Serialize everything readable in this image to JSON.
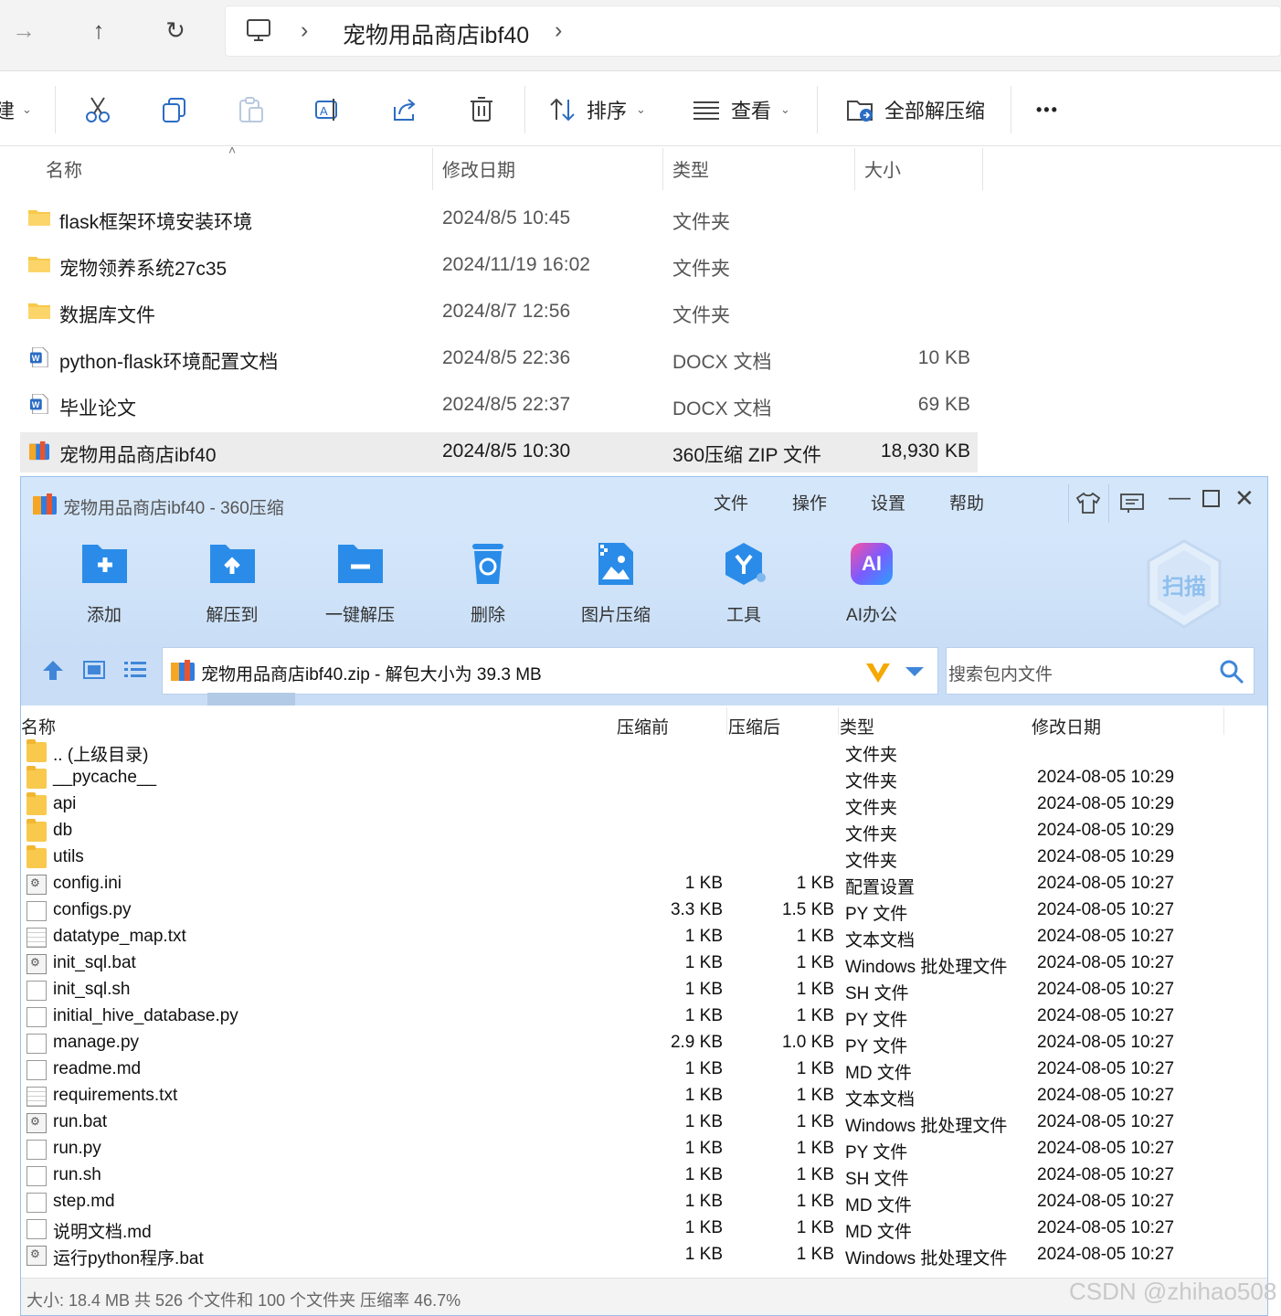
{
  "explorer": {
    "address": {
      "crumb": "宠物用品商店ibf40"
    },
    "toolbar": {
      "new_label": "建",
      "sort_label": "排序",
      "view_label": "查看",
      "extract_all_label": "全部解压缩",
      "more_label": "•••"
    },
    "columns": {
      "name": "名称",
      "modified": "修改日期",
      "type": "类型",
      "size": "大小"
    },
    "files": [
      {
        "name": "flask框架环境安装环境",
        "modified": "2024/8/5 10:45",
        "type": "文件夹",
        "size": "",
        "icon": "folder-icon"
      },
      {
        "name": "宠物领养系统27c35",
        "modified": "2024/11/19 16:02",
        "type": "文件夹",
        "size": "",
        "icon": "folder-icon"
      },
      {
        "name": "数据库文件",
        "modified": "2024/8/7 12:56",
        "type": "文件夹",
        "size": "",
        "icon": "folder-icon"
      },
      {
        "name": "python-flask环境配置文档",
        "modified": "2024/8/5 22:36",
        "type": "DOCX 文档",
        "size": "10 KB",
        "icon": "word-doc-icon"
      },
      {
        "name": "毕业论文",
        "modified": "2024/8/5 22:37",
        "type": "DOCX 文档",
        "size": "69 KB",
        "icon": "word-doc-icon"
      },
      {
        "name": "宠物用品商店ibf40",
        "modified": "2024/8/5 10:30",
        "type": "360压缩 ZIP 文件",
        "size": "18,930 KB",
        "icon": "zip-archive-icon",
        "selected": true
      }
    ]
  },
  "zip360": {
    "title": "宠物用品商店ibf40 - 360压缩",
    "menu": [
      "文件",
      "操作",
      "设置",
      "帮助"
    ],
    "tools": [
      {
        "label": "添加",
        "icon": "add-icon"
      },
      {
        "label": "解压到",
        "icon": "extract-to-icon"
      },
      {
        "label": "一键解压",
        "icon": "one-click-extract-icon"
      },
      {
        "label": "删除",
        "icon": "delete-icon"
      },
      {
        "label": "图片压缩",
        "icon": "image-compress-icon"
      },
      {
        "label": "工具",
        "icon": "tools-icon"
      },
      {
        "label": "AI办公",
        "icon": "ai-office-icon"
      }
    ],
    "ai_badge": "AI",
    "scan_label": "扫描",
    "path_text": "宠物用品商店ibf40.zip - 解包大小为 39.3 MB",
    "search_placeholder": "搜索包内文件",
    "columns": {
      "name": "名称",
      "before": "压缩前",
      "after": "压缩后",
      "type": "类型",
      "modified": "修改日期"
    },
    "rows": [
      {
        "name": ".. (上级目录)",
        "before": "",
        "after": "",
        "type": "文件夹",
        "modified": "",
        "icon": "folder"
      },
      {
        "name": "__pycache__",
        "before": "",
        "after": "",
        "type": "文件夹",
        "modified": "2024-08-05 10:29",
        "icon": "folder"
      },
      {
        "name": "api",
        "before": "",
        "after": "",
        "type": "文件夹",
        "modified": "2024-08-05 10:29",
        "icon": "folder"
      },
      {
        "name": "db",
        "before": "",
        "after": "",
        "type": "文件夹",
        "modified": "2024-08-05 10:29",
        "icon": "folder"
      },
      {
        "name": "utils",
        "before": "",
        "after": "",
        "type": "文件夹",
        "modified": "2024-08-05 10:29",
        "icon": "folder"
      },
      {
        "name": "config.ini",
        "before": "1 KB",
        "after": "1 KB",
        "type": "配置设置",
        "modified": "2024-08-05 10:27",
        "icon": "settings"
      },
      {
        "name": "configs.py",
        "before": "3.3 KB",
        "after": "1.5 KB",
        "type": "PY 文件",
        "modified": "2024-08-05 10:27",
        "icon": "doc"
      },
      {
        "name": "datatype_map.txt",
        "before": "1 KB",
        "after": "1 KB",
        "type": "文本文档",
        "modified": "2024-08-05 10:27",
        "icon": "text"
      },
      {
        "name": "init_sql.bat",
        "before": "1 KB",
        "after": "1 KB",
        "type": "Windows 批处理文件",
        "modified": "2024-08-05 10:27",
        "icon": "bat"
      },
      {
        "name": "init_sql.sh",
        "before": "1 KB",
        "after": "1 KB",
        "type": "SH 文件",
        "modified": "2024-08-05 10:27",
        "icon": "doc"
      },
      {
        "name": "initial_hive_database.py",
        "before": "1 KB",
        "after": "1 KB",
        "type": "PY 文件",
        "modified": "2024-08-05 10:27",
        "icon": "doc"
      },
      {
        "name": "manage.py",
        "before": "2.9 KB",
        "after": "1.0 KB",
        "type": "PY 文件",
        "modified": "2024-08-05 10:27",
        "icon": "doc"
      },
      {
        "name": "readme.md",
        "before": "1 KB",
        "after": "1 KB",
        "type": "MD 文件",
        "modified": "2024-08-05 10:27",
        "icon": "doc"
      },
      {
        "name": "requirements.txt",
        "before": "1 KB",
        "after": "1 KB",
        "type": "文本文档",
        "modified": "2024-08-05 10:27",
        "icon": "text"
      },
      {
        "name": "run.bat",
        "before": "1 KB",
        "after": "1 KB",
        "type": "Windows 批处理文件",
        "modified": "2024-08-05 10:27",
        "icon": "bat"
      },
      {
        "name": "run.py",
        "before": "1 KB",
        "after": "1 KB",
        "type": "PY 文件",
        "modified": "2024-08-05 10:27",
        "icon": "doc"
      },
      {
        "name": "run.sh",
        "before": "1 KB",
        "after": "1 KB",
        "type": "SH 文件",
        "modified": "2024-08-05 10:27",
        "icon": "doc"
      },
      {
        "name": "step.md",
        "before": "1 KB",
        "after": "1 KB",
        "type": "MD 文件",
        "modified": "2024-08-05 10:27",
        "icon": "doc"
      },
      {
        "name": "说明文档.md",
        "before": "1 KB",
        "after": "1 KB",
        "type": "MD 文件",
        "modified": "2024-08-05 10:27",
        "icon": "doc"
      },
      {
        "name": "运行python程序.bat",
        "before": "1 KB",
        "after": "1 KB",
        "type": "Windows 批处理文件",
        "modified": "2024-08-05 10:27",
        "icon": "bat"
      }
    ],
    "status": "大小: 18.4 MB 共 526 个文件和 100 个文件夹 压缩率 46.7%"
  },
  "watermark": "CSDN @zhihao508"
}
